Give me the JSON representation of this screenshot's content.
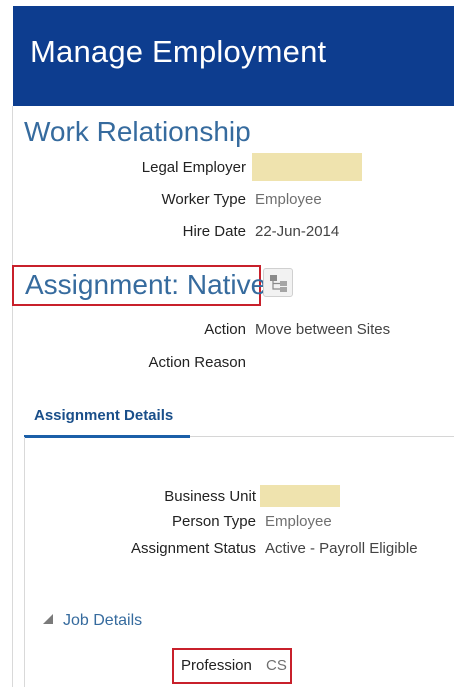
{
  "header": {
    "title": "Manage Employment"
  },
  "work_relationship": {
    "heading": "Work Relationship",
    "legal_employer": {
      "label": "Legal Employer",
      "value": ""
    },
    "worker_type": {
      "label": "Worker Type",
      "value": "Employee"
    },
    "hire_date": {
      "label": "Hire Date",
      "value": "22-Jun-2014"
    }
  },
  "assignment": {
    "heading": "Assignment: Native",
    "org_chart_icon": "org-chart-icon",
    "action": {
      "label": "Action",
      "value": "Move between Sites"
    },
    "action_reason": {
      "label": "Action Reason",
      "value": ""
    }
  },
  "tabs": [
    {
      "label": "Assignment Details",
      "active": true
    }
  ],
  "assignment_details": {
    "business_unit": {
      "label": "Business Unit",
      "value": ""
    },
    "person_type": {
      "label": "Person Type",
      "value": "Employee"
    },
    "assignment_status": {
      "label": "Assignment Status",
      "value": "Active - Payroll Eligible"
    }
  },
  "job_details": {
    "title": "Job Details",
    "expanded": true,
    "profession": {
      "label": "Profession",
      "value": "CS"
    }
  },
  "colors": {
    "banner": "#0d3d8f",
    "heading": "#366b9e",
    "highlight_border": "#c8202b",
    "redacted_field": "#efe3ae"
  }
}
